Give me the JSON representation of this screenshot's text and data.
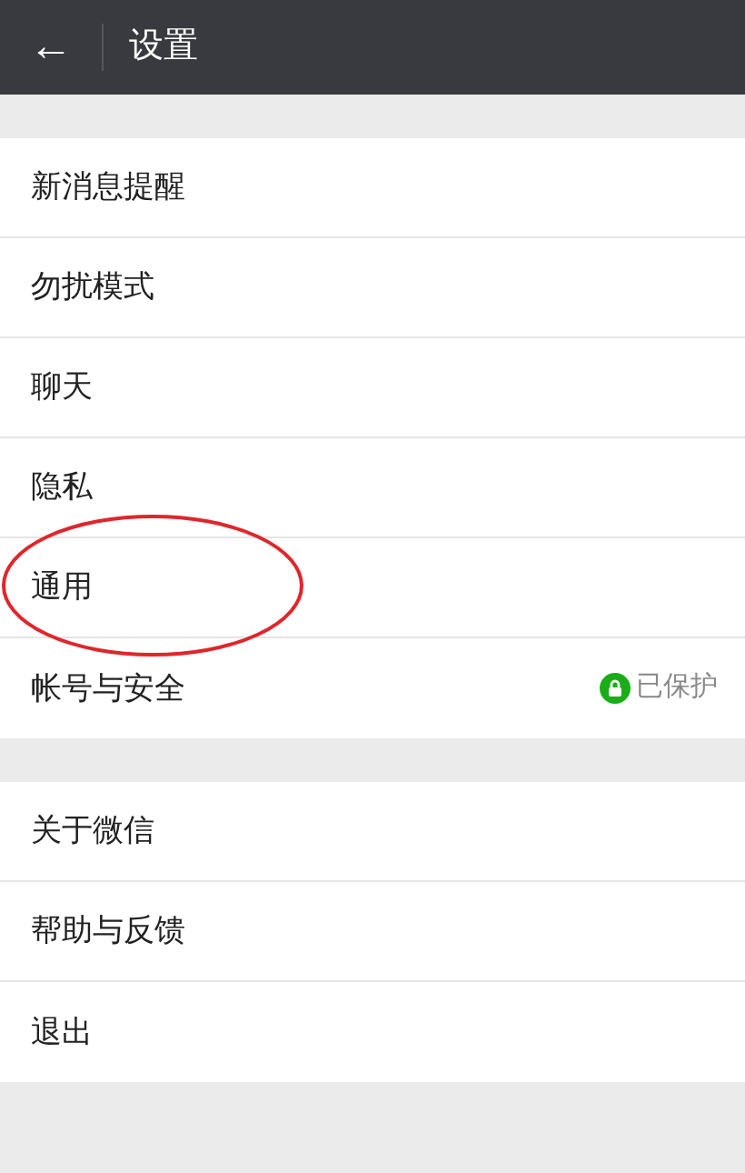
{
  "top_bar": {
    "back": "←",
    "title": "设置"
  },
  "groups": [
    {
      "items": [
        {
          "label": "新消息提醒",
          "circled": false
        },
        {
          "label": "勿扰模式",
          "circled": false
        },
        {
          "label": "聊天",
          "circled": false
        },
        {
          "label": "隐私",
          "circled": false
        },
        {
          "label": "通用",
          "circled": true
        },
        {
          "label": "帐号与安全",
          "circled": false,
          "status": "已保护"
        }
      ]
    },
    {
      "items": [
        {
          "label": "关于微信",
          "circled": false
        },
        {
          "label": "帮助与反馈",
          "circled": false
        },
        {
          "label": "退出",
          "circled": false
        }
      ]
    }
  ]
}
